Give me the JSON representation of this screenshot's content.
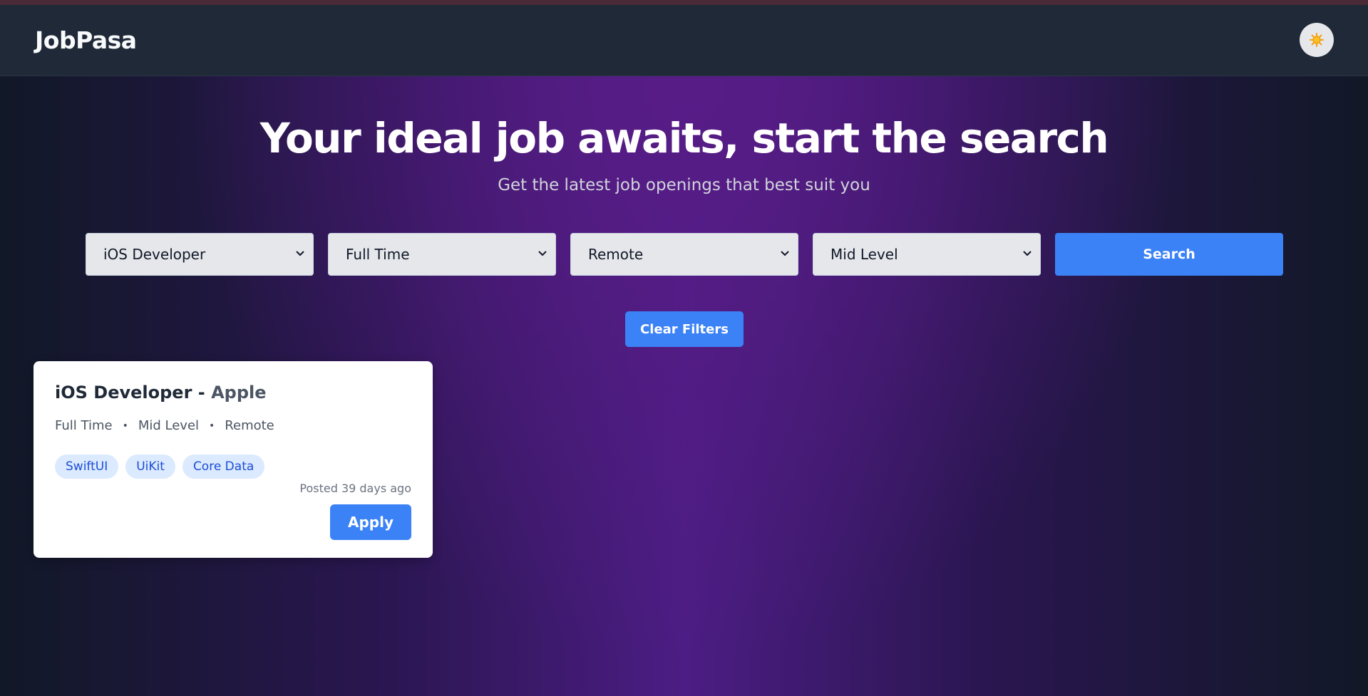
{
  "navbar": {
    "brand": "JobPasa",
    "theme_toggle_icon": "sun-icon"
  },
  "hero": {
    "headline": "Your ideal job awaits, start the search",
    "subheadline": "Get the latest job openings that best suit you"
  },
  "filters": {
    "role": "iOS Developer",
    "job_type": "Full Time",
    "location_type": "Remote",
    "level": "Mid Level",
    "search_label": "Search",
    "clear_label": "Clear Filters"
  },
  "jobs": [
    {
      "title": "iOS Developer",
      "separator": " - ",
      "company": "Apple",
      "job_type": "Full Time",
      "level": "Mid Level",
      "location_type": "Remote",
      "meta_separator": "•",
      "tags": [
        "SwiftUI",
        "UiKit",
        "Core Data"
      ],
      "posted": "Posted 39 days ago",
      "apply_label": "Apply"
    }
  ],
  "colors": {
    "accent": "#3b82f6",
    "navbar": "#1f2937",
    "hero_purple": "#581c87",
    "tag_bg": "#dbeafe",
    "tag_text": "#1d4ed8"
  }
}
